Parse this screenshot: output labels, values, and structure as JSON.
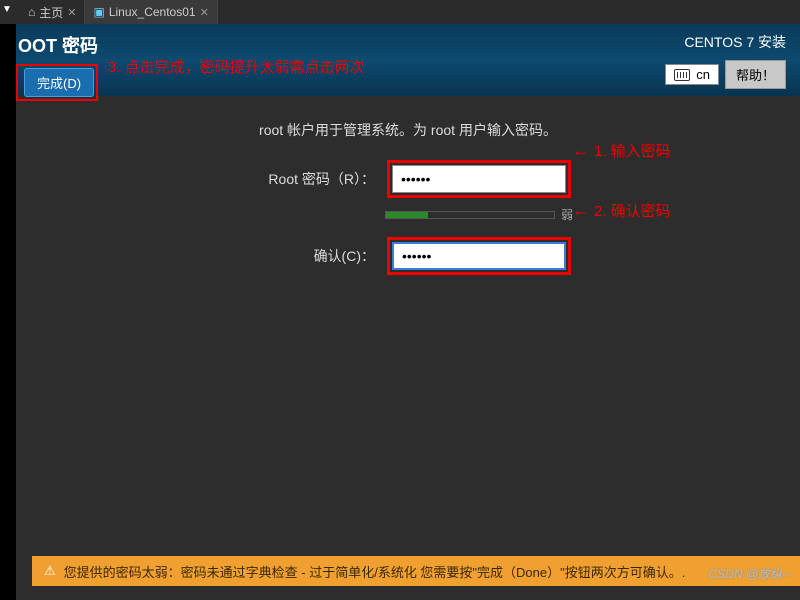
{
  "tabs": {
    "home": "主页",
    "vm": "Linux_Centos01"
  },
  "header": {
    "title": "OOT 密码",
    "done_label": "完成(D)",
    "install_label": "CENTOS 7 安装",
    "keyboard": "cn",
    "help_label": "帮助！"
  },
  "content": {
    "description": "root 帐户用于管理系统。为 root 用户输入密码。",
    "root_label": "Root 密码（R）：",
    "root_value": "••••••",
    "confirm_label": "确认(C)：",
    "confirm_value": "••••••",
    "strength_label": "弱"
  },
  "annotations": {
    "done": "3. 点击完成，密码提升太弱需点击两次",
    "password": "1. 输入密码",
    "confirm": "2. 确认密码"
  },
  "footer": {
    "warning": "您提供的密码太弱：密码未通过字典检查 - 过于简单化/系统化 您需要按\"完成（Done）\"按钮两次方可确认。."
  },
  "watermark": "CSDN @放纵--"
}
